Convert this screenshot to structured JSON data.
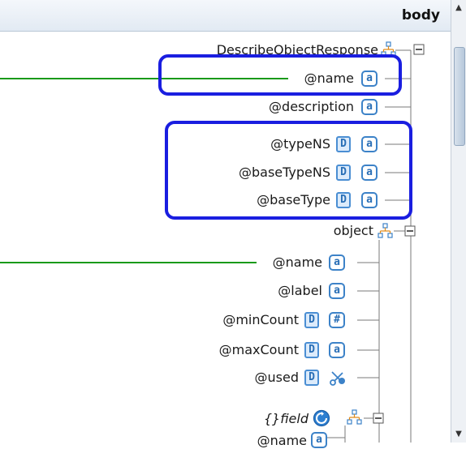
{
  "header": {
    "title": "body"
  },
  "nodes": {
    "describe_object_response": "DescribeObjectResponse",
    "name_1": "@name",
    "description": "@description",
    "type_ns": "@typeNS",
    "base_type_ns": "@baseTypeNS",
    "base_type": "@baseType",
    "object": "object",
    "name_2": "@name",
    "label": "@label",
    "min_count": "@minCount",
    "max_count": "@maxCount",
    "used": "@used",
    "field": "{}field",
    "name_3": "@name"
  },
  "badges": {
    "attribute": "a",
    "data": "D",
    "number": "#"
  },
  "icons": {
    "sequence": "sequence-compositor-icon",
    "collapse": "collapse-box-icon",
    "scissors": "unused-attribute-icon",
    "loop": "repeating-element-icon"
  },
  "colors": {
    "highlight": "#1a1ee0",
    "connector_line": "#1a9a1a",
    "tree_line": "#7a7a7a",
    "badge_border": "#3c82c8"
  }
}
